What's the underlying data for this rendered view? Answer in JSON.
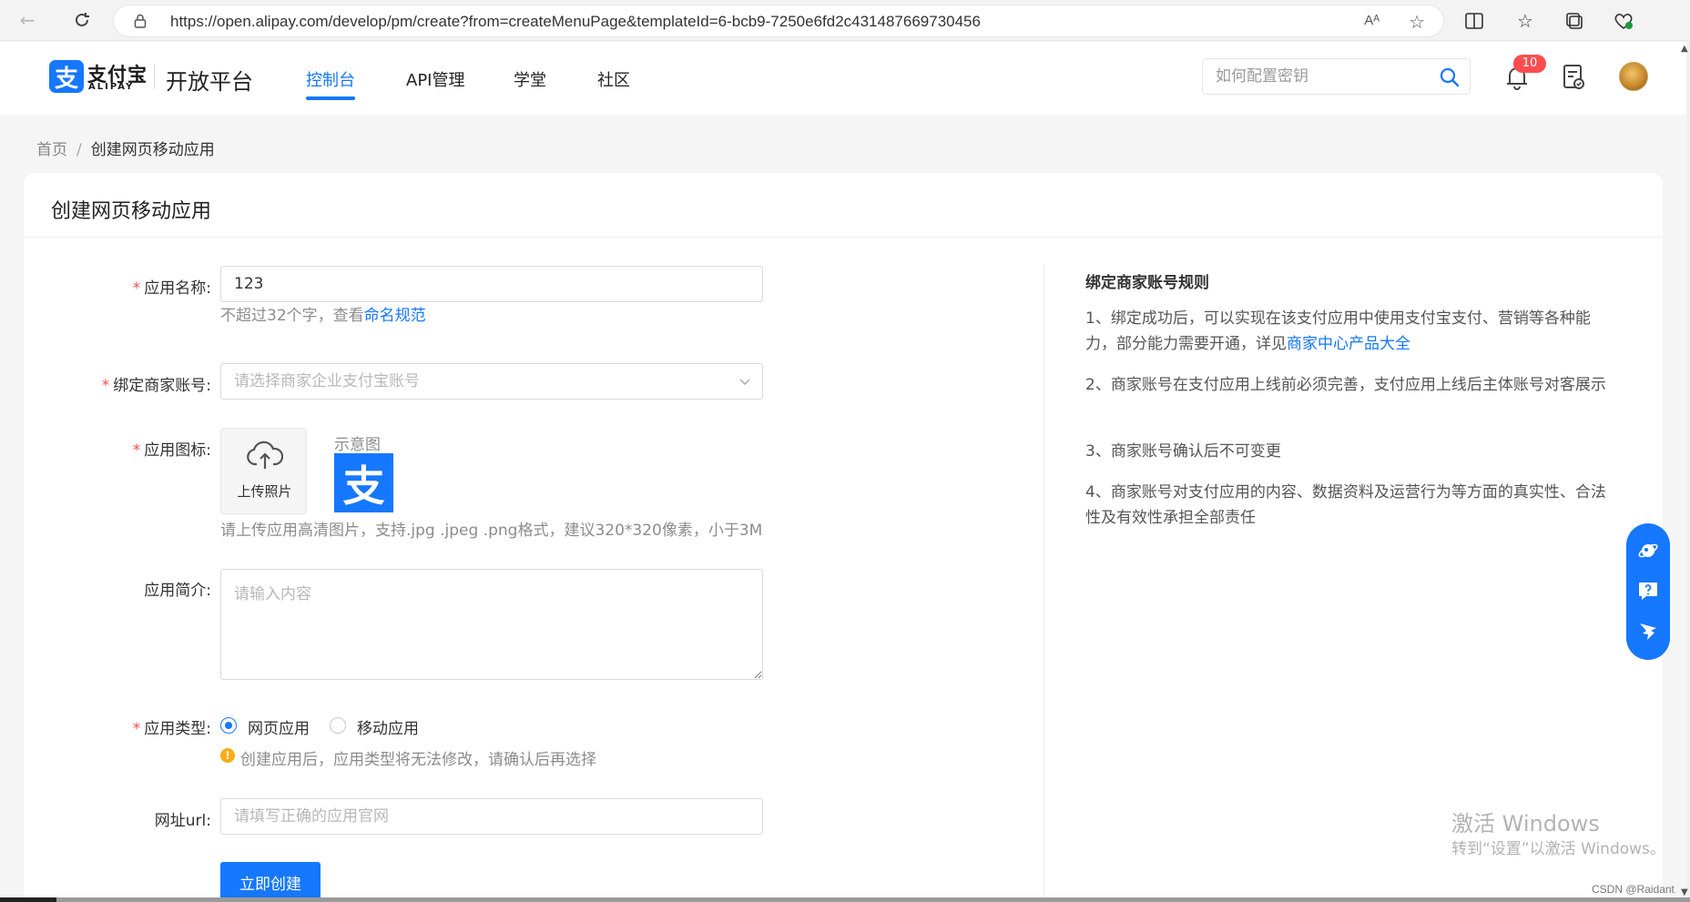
{
  "browser": {
    "url": "https://open.alipay.com/develop/pm/create?from=createMenuPage&templateId=6-bcb9-7250e6fd2c431487669730456",
    "read_aloud_label": "Aᴬ"
  },
  "header": {
    "logo_cn": "支付宝",
    "logo_en": "ALIPAY",
    "logo_glyph": "支",
    "platform": "开放平台",
    "nav": [
      "控制台",
      "API管理",
      "学堂",
      "社区"
    ],
    "active_nav": "控制台",
    "search_placeholder": "如何配置密钥",
    "notification_count": "10",
    "accent_color": "#1677ff"
  },
  "breadcrumb": {
    "home": "首页",
    "separator": "/",
    "current": "创建网页移动应用"
  },
  "form": {
    "title": "创建网页移动应用",
    "app_name": {
      "label": "应用名称:",
      "value": "123",
      "help_prefix": "不超过32个字，查看",
      "help_link": "命名规范"
    },
    "merchant": {
      "label": "绑定商家账号:",
      "placeholder": "请选择商家企业支付宝账号"
    },
    "icon": {
      "label": "应用图标:",
      "upload_text": "上传照片",
      "sample_label": "示意图",
      "sample_glyph": "支",
      "help": "请上传应用高清图片，支持.jpg .jpeg .png格式，建议320*320像素，小于3M"
    },
    "intro": {
      "label": "应用简介:",
      "placeholder": "请输入内容"
    },
    "type": {
      "label": "应用类型:",
      "options": [
        "网页应用",
        "移动应用"
      ],
      "selected": "网页应用",
      "warning": "创建应用后，应用类型将无法修改，请确认后再选择",
      "warning_glyph": "!"
    },
    "url": {
      "label": "网址url:",
      "placeholder": "请填写正确的应用官网"
    },
    "submit_label": "立即创建",
    "required_mark": "*"
  },
  "rules": {
    "title": "绑定商家账号规则",
    "items": [
      {
        "text": "1、绑定成功后，可以实现在该支付应用中使用支付宝支付、营销等各种能力，部分能力需要开通，详见",
        "link": "商家中心产品大全"
      },
      {
        "text": "2、商家账号在支付应用上线前必须完善，支付应用上线后主体账号对客展示"
      },
      {
        "text": "3、商家账号确认后不可变更"
      },
      {
        "text": "4、商家账号对支付应用的内容、数据资料及运营行为等方面的真实性、合法性及有效性承担全部责任"
      }
    ]
  },
  "overlay": {
    "watermark_title": "激活 Windows",
    "watermark_sub": "转到“设置”以激活 Windows。",
    "csdn": "CSDN @Raidant"
  }
}
